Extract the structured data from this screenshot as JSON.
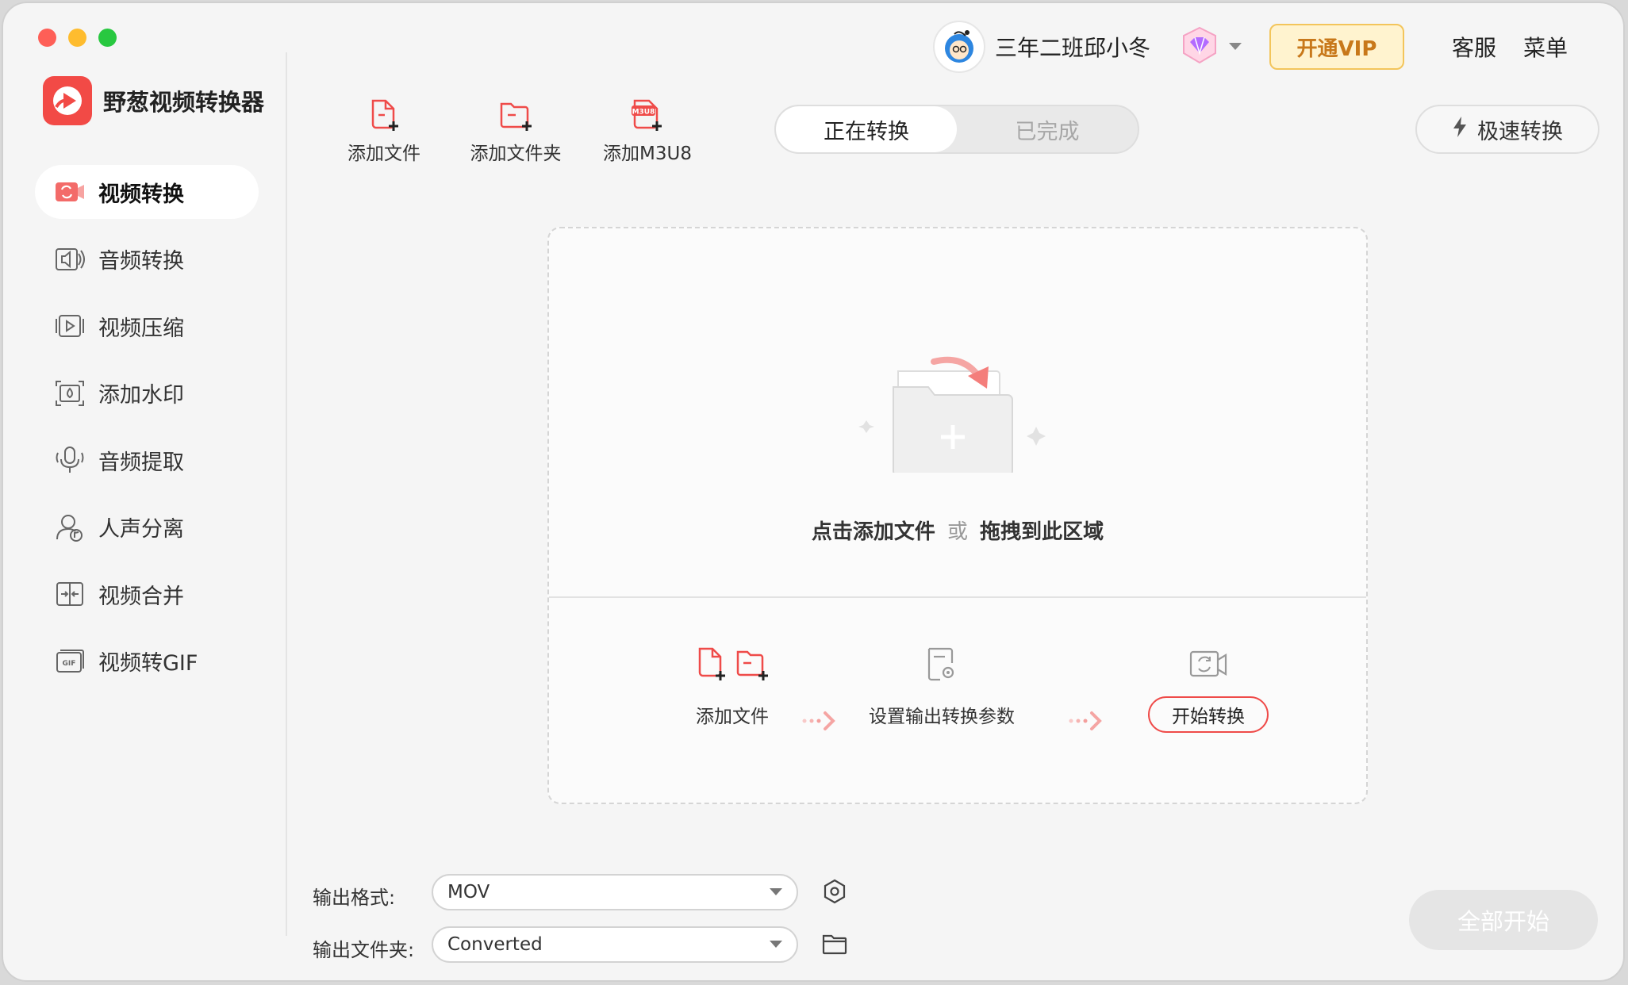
{
  "app": {
    "name": "野葱视频转换器"
  },
  "header": {
    "username": "三年二班邱小冬",
    "vip_label": "开通VIP",
    "service_label": "客服",
    "menu_label": "菜单"
  },
  "sidebar": {
    "items": [
      {
        "label": "视频转换",
        "icon": "video-convert-icon",
        "active": true
      },
      {
        "label": "音频转换",
        "icon": "audio-convert-icon",
        "active": false
      },
      {
        "label": "视频压缩",
        "icon": "video-compress-icon",
        "active": false
      },
      {
        "label": "添加水印",
        "icon": "watermark-icon",
        "active": false
      },
      {
        "label": "音频提取",
        "icon": "audio-extract-icon",
        "active": false
      },
      {
        "label": "人声分离",
        "icon": "vocal-separate-icon",
        "active": false
      },
      {
        "label": "视频合并",
        "icon": "video-merge-icon",
        "active": false
      },
      {
        "label": "视频转GIF",
        "icon": "video-to-gif-icon",
        "active": false
      }
    ]
  },
  "toolbar": {
    "add_file": "添加文件",
    "add_folder": "添加文件夹",
    "add_m3u8": "添加M3U8"
  },
  "tabs": {
    "converting": "正在转换",
    "done": "已完成"
  },
  "fast_convert": "极速转换",
  "dropzone": {
    "hint_a": "点击添加文件",
    "hint_or": "或",
    "hint_b": "拖拽到此区域",
    "steps": {
      "step1": "添加文件",
      "step2": "设置输出转换参数",
      "step3": "开始转换"
    }
  },
  "output": {
    "format_label": "输出格式:",
    "format_value": "MOV",
    "folder_label": "输出文件夹:",
    "folder_value": "Converted"
  },
  "start_all": "全部开始",
  "colors": {
    "accent": "#ef4b49",
    "vip_bg": "#fff3cf",
    "vip_text": "#c8781a"
  }
}
